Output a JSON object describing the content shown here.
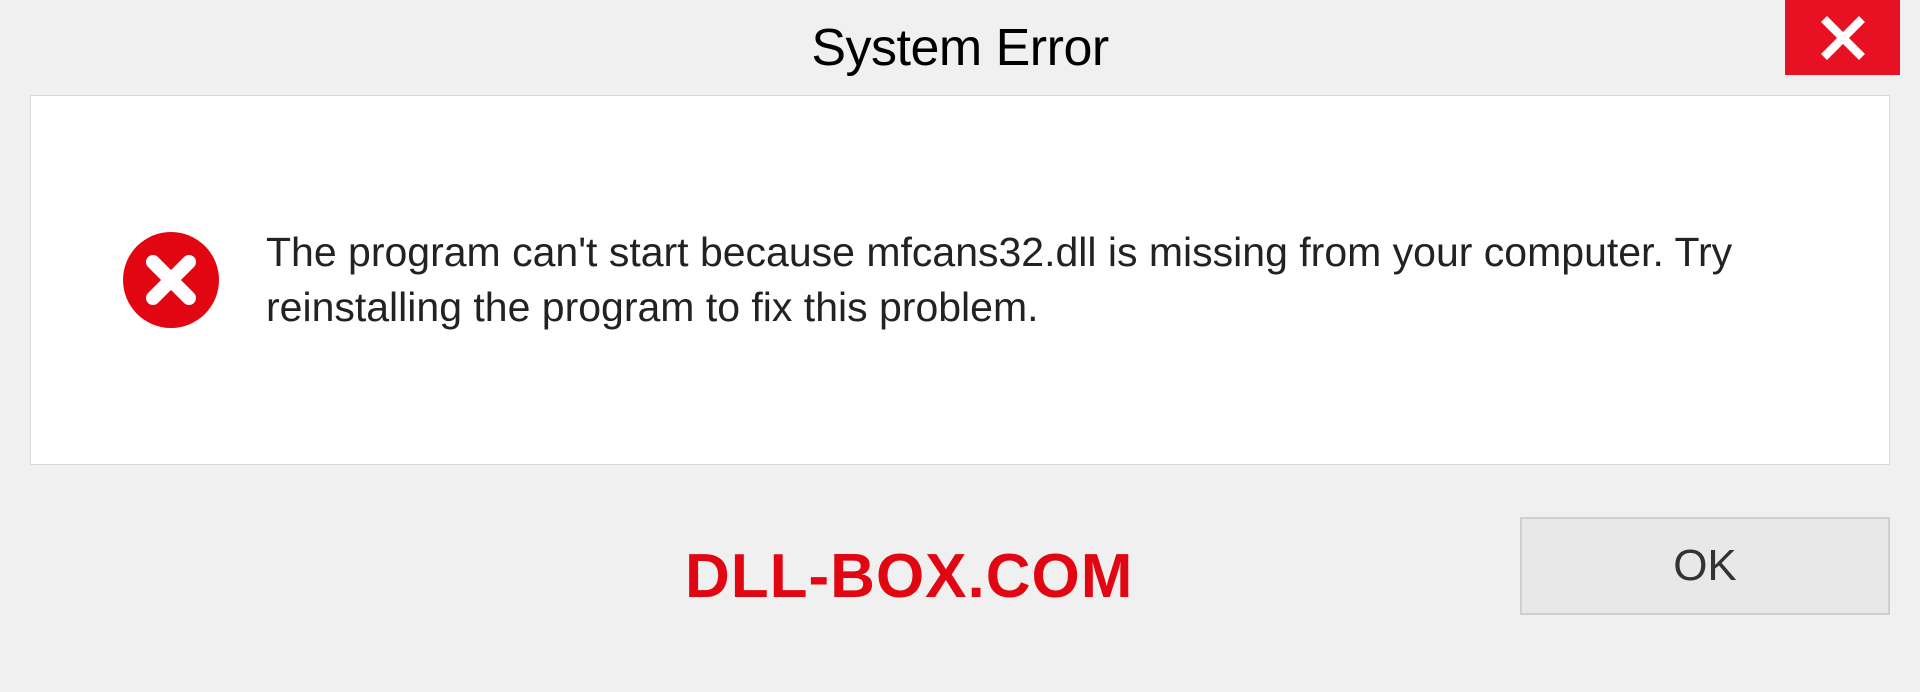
{
  "dialog": {
    "title": "System Error",
    "message": "The program can't start because mfcans32.dll is missing from your computer. Try reinstalling the program to fix this problem.",
    "ok_label": "OK"
  },
  "watermark": "DLL-BOX.COM",
  "icons": {
    "close": "close-icon",
    "error": "error-icon"
  },
  "colors": {
    "close_bg": "#e81123",
    "error_red": "#e20613",
    "watermark": "#e20613"
  }
}
